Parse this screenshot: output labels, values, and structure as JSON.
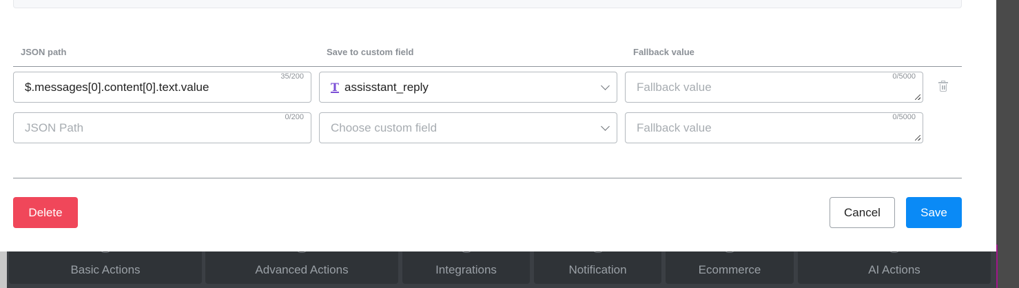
{
  "columns": {
    "json_path": "JSON path",
    "save_to": "Save to custom field",
    "fallback": "Fallback value"
  },
  "rows": [
    {
      "json_path": "$.messages[0].content[0].text.value",
      "json_path_counter": "35/200",
      "custom_field": "assisstant_reply",
      "custom_field_icon": "text-field-icon",
      "fallback_placeholder": "Fallback value",
      "fallback_counter": "0/5000"
    },
    {
      "json_path_placeholder": "JSON Path",
      "json_path_counter": "0/200",
      "custom_field_placeholder": "Choose custom field",
      "fallback_placeholder": "Fallback value",
      "fallback_counter": "0/5000"
    }
  ],
  "buttons": {
    "delete": "Delete",
    "cancel": "Cancel",
    "save": "Save"
  },
  "background_tabs": [
    "Basic Actions",
    "Advanced Actions",
    "Integrations",
    "Notification",
    "Ecommerce",
    "AI Actions"
  ],
  "colors": {
    "delete": "#f0475a",
    "save": "#0a8af6",
    "field_type_icon": "#7b4fd6"
  }
}
